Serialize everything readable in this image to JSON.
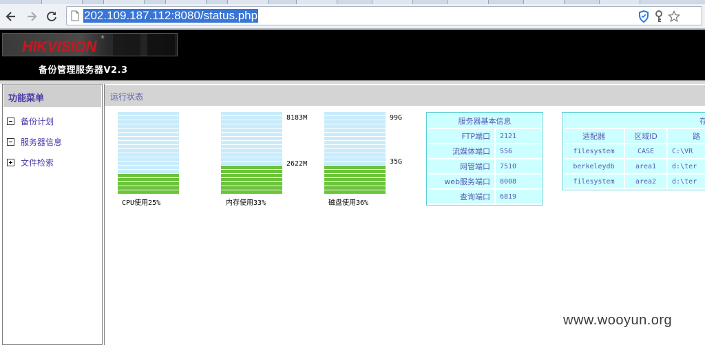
{
  "browser": {
    "url": "202.109.187.112:8080/status.php",
    "icons": [
      "back-icon",
      "forward-icon",
      "reload-icon",
      "page-icon",
      "shield-icon",
      "key-icon",
      "star-icon"
    ]
  },
  "header": {
    "logo": "HIKVISION",
    "app_title": "备份管理服务器V2.3"
  },
  "menu": {
    "title": "功能菜单",
    "items": [
      {
        "label": "备份计划",
        "state": "expanded"
      },
      {
        "label": "服务器信息",
        "state": "expanded"
      },
      {
        "label": "文件检索",
        "state": "collapsed"
      }
    ]
  },
  "main": {
    "title": "运行状态"
  },
  "gauges": [
    {
      "id": "cpu",
      "caption": "CPU使用25%",
      "usage_percent": 25,
      "labels": []
    },
    {
      "id": "memory",
      "caption": "内存使用33%",
      "usage_percent": 33,
      "labels": [
        "8183M",
        "2622M"
      ]
    },
    {
      "id": "disk",
      "caption": "磁盘使用36%",
      "usage_percent": 36,
      "labels": [
        "99G",
        "35G"
      ]
    }
  ],
  "server_info": {
    "title": "服务器基本信息",
    "rows": [
      {
        "label": "FTP端口",
        "value": "2121"
      },
      {
        "label": "流媒体端口",
        "value": "556"
      },
      {
        "label": "网管端口",
        "value": "7510"
      },
      {
        "label": "web服务端口",
        "value": "8008"
      },
      {
        "label": "查询端口",
        "value": "6819"
      }
    ]
  },
  "storage": {
    "title": "存储区",
    "headers": [
      "适配器",
      "区域ID",
      "路"
    ],
    "rows": [
      [
        "filesystem",
        "CASE",
        "C:\\VR"
      ],
      [
        "berkeleydb",
        "area1",
        "d:\\ter"
      ],
      [
        "filesystem",
        "area2",
        "d:\\ter"
      ]
    ]
  },
  "colors": {
    "empty_bar": "#c8ecfb",
    "used_bar": "#6cc43c",
    "table_cell": "#ccffff",
    "table_border": "#55cfd3",
    "label_text": "#5a5ab4"
  },
  "watermark": "www.wooyun.org"
}
